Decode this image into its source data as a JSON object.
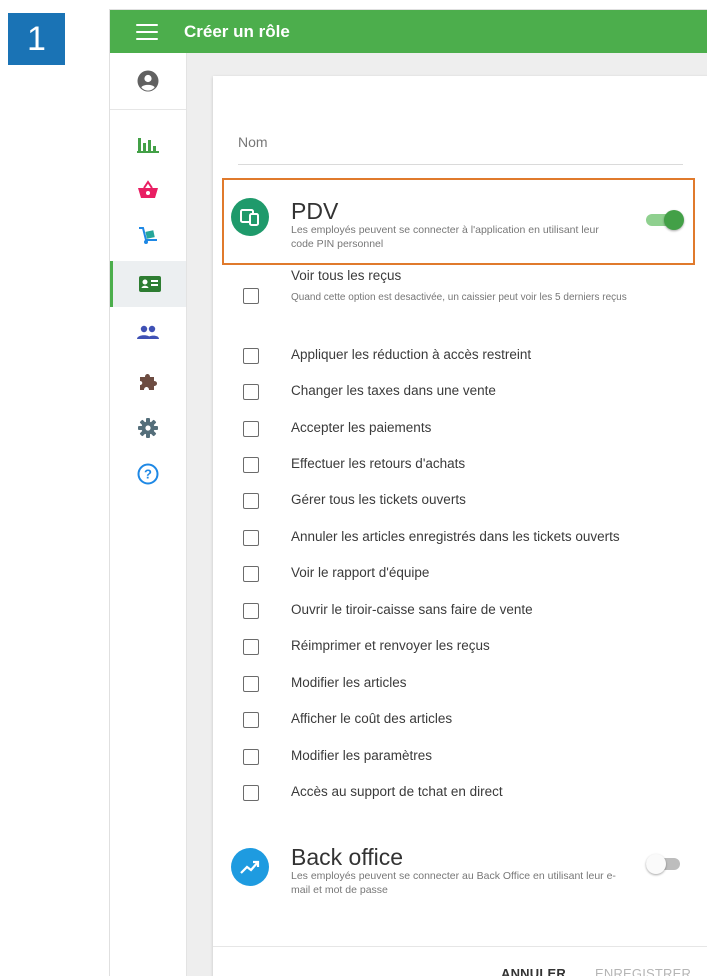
{
  "step_badge": "1",
  "appbar": {
    "title": "Créer un rôle"
  },
  "form": {
    "name_label": "Nom"
  },
  "pdv": {
    "title": "PDV",
    "description": "Les employés peuvent se connecter à l'application en utilisant leur code PIN personnel",
    "enabled": true
  },
  "permissions": [
    {
      "label": "Voir tous les reçus",
      "sub": "Quand cette option est desactivée, un caissier peut voir les 5 derniers reçus",
      "checked": false
    },
    {
      "label": "Appliquer les réduction à accès restreint",
      "checked": false
    },
    {
      "label": "Changer les taxes dans une vente",
      "checked": false
    },
    {
      "label": "Accepter les paiements",
      "checked": false
    },
    {
      "label": "Effectuer les retours d'achats",
      "checked": false
    },
    {
      "label": "Gérer tous les tickets ouverts",
      "checked": false
    },
    {
      "label": "Annuler les articles enregistrés dans les tickets ouverts",
      "checked": false
    },
    {
      "label": "Voir le rapport d'équipe",
      "checked": false
    },
    {
      "label": "Ouvrir le tiroir-caisse sans faire de vente",
      "checked": false
    },
    {
      "label": "Réimprimer et renvoyer les reçus",
      "checked": false
    },
    {
      "label": "Modifier les articles",
      "checked": false
    },
    {
      "label": "Afficher le coût des articles",
      "checked": false
    },
    {
      "label": "Modifier les paramètres",
      "checked": false
    },
    {
      "label": "Accès au support de tchat en direct",
      "checked": false
    }
  ],
  "back_office": {
    "title": "Back office",
    "description": "Les employés peuvent se connecter au Back Office en utilisant leur e-mail et mot de passe",
    "enabled": false
  },
  "footer": {
    "cancel_label": "ANNULER",
    "save_label": "ENREGISTRER"
  },
  "sidebar_icons": [
    "account-circle-icon",
    "bar-chart-icon",
    "basket-icon",
    "dolly-icon",
    "id-card-icon",
    "people-icon",
    "puzzle-icon",
    "gear-icon",
    "help-icon"
  ],
  "colors": {
    "primary_green": "#4cae4c",
    "step_badge_blue": "#1a73b5",
    "highlight_orange": "#e07a2c",
    "pdv_icon": "#1f9a6b",
    "back_office_icon": "#1e9be0",
    "basket_pink": "#e91e63",
    "people_indigo": "#3f51b5",
    "help_blue": "#1e88e5"
  }
}
